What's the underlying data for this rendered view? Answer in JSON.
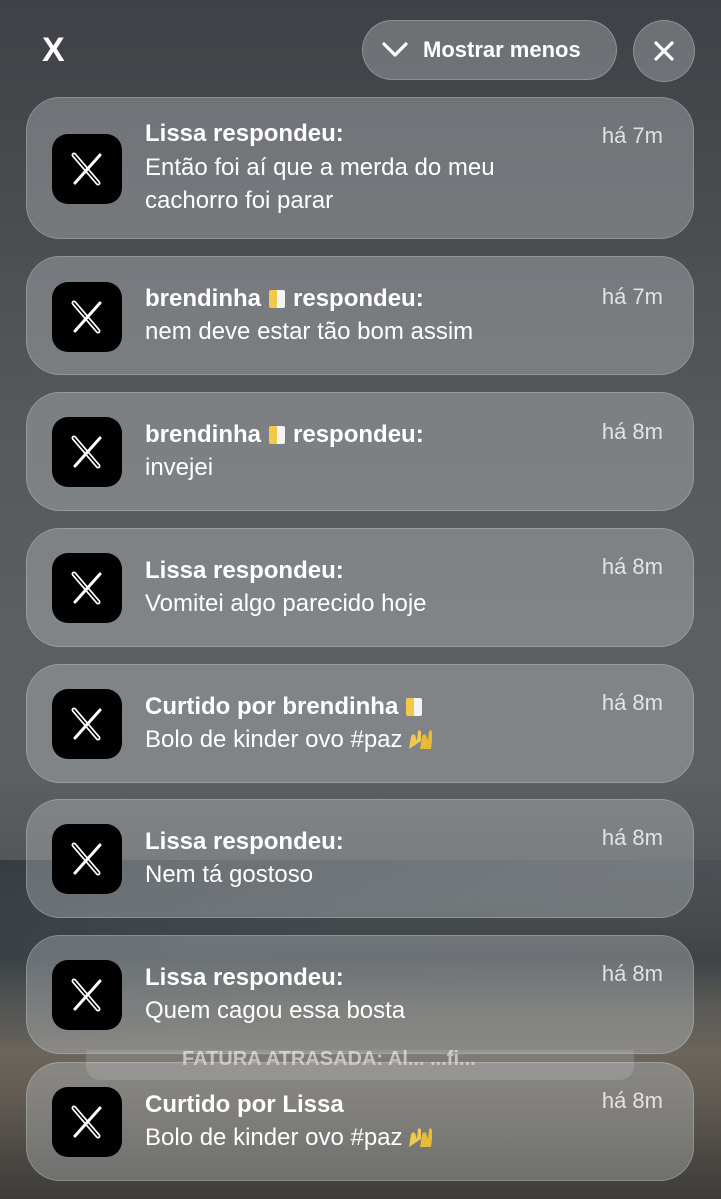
{
  "header": {
    "app_glyph": "X",
    "collapse_label": "Mostrar menos",
    "icons": {
      "collapse": "chevron-down-icon",
      "close": "close-icon",
      "app": "x-logo-icon"
    }
  },
  "notifications": [
    {
      "title_name": "Lissa",
      "title_action": "respondeu:",
      "body": "Então foi aí que a merda do meu cachorro foi parar",
      "time": "há 7m"
    },
    {
      "title_name": "brendinha",
      "title_action": "respondeu:",
      "body": "nem deve estar tão bom assim",
      "time": "há 7m"
    },
    {
      "title_name": "brendinha",
      "title_action": "respondeu:",
      "body": "invejei",
      "time": "há 8m"
    },
    {
      "title_name": "Lissa",
      "title_action": "respondeu:",
      "body": "Vomitei algo parecido hoje",
      "time": "há 8m"
    },
    {
      "title_prefix": "Curtido por",
      "title_name": "brendinha",
      "body": "Bolo de kinder ovo #paz",
      "time": "há 8m"
    },
    {
      "title_name": "Lissa",
      "title_action": "respondeu:",
      "body": "Nem tá gostoso",
      "time": "há 8m"
    },
    {
      "title_name": "Lissa",
      "title_action": "respondeu:",
      "body": "Quem cagou essa bosta",
      "time": "há 8m"
    },
    {
      "title_prefix": "Curtido por",
      "title_name": "Lissa",
      "body": "Bolo de kinder ovo #paz",
      "time": "há 8m"
    }
  ],
  "peek_text": "FATURA ATRASADA: Al... ...fi...",
  "colors": {
    "icon_bg": "#000000",
    "card_text": "#ffffff",
    "flag_yellow": "#f2c94c",
    "flag_white": "#f4f4f4"
  }
}
